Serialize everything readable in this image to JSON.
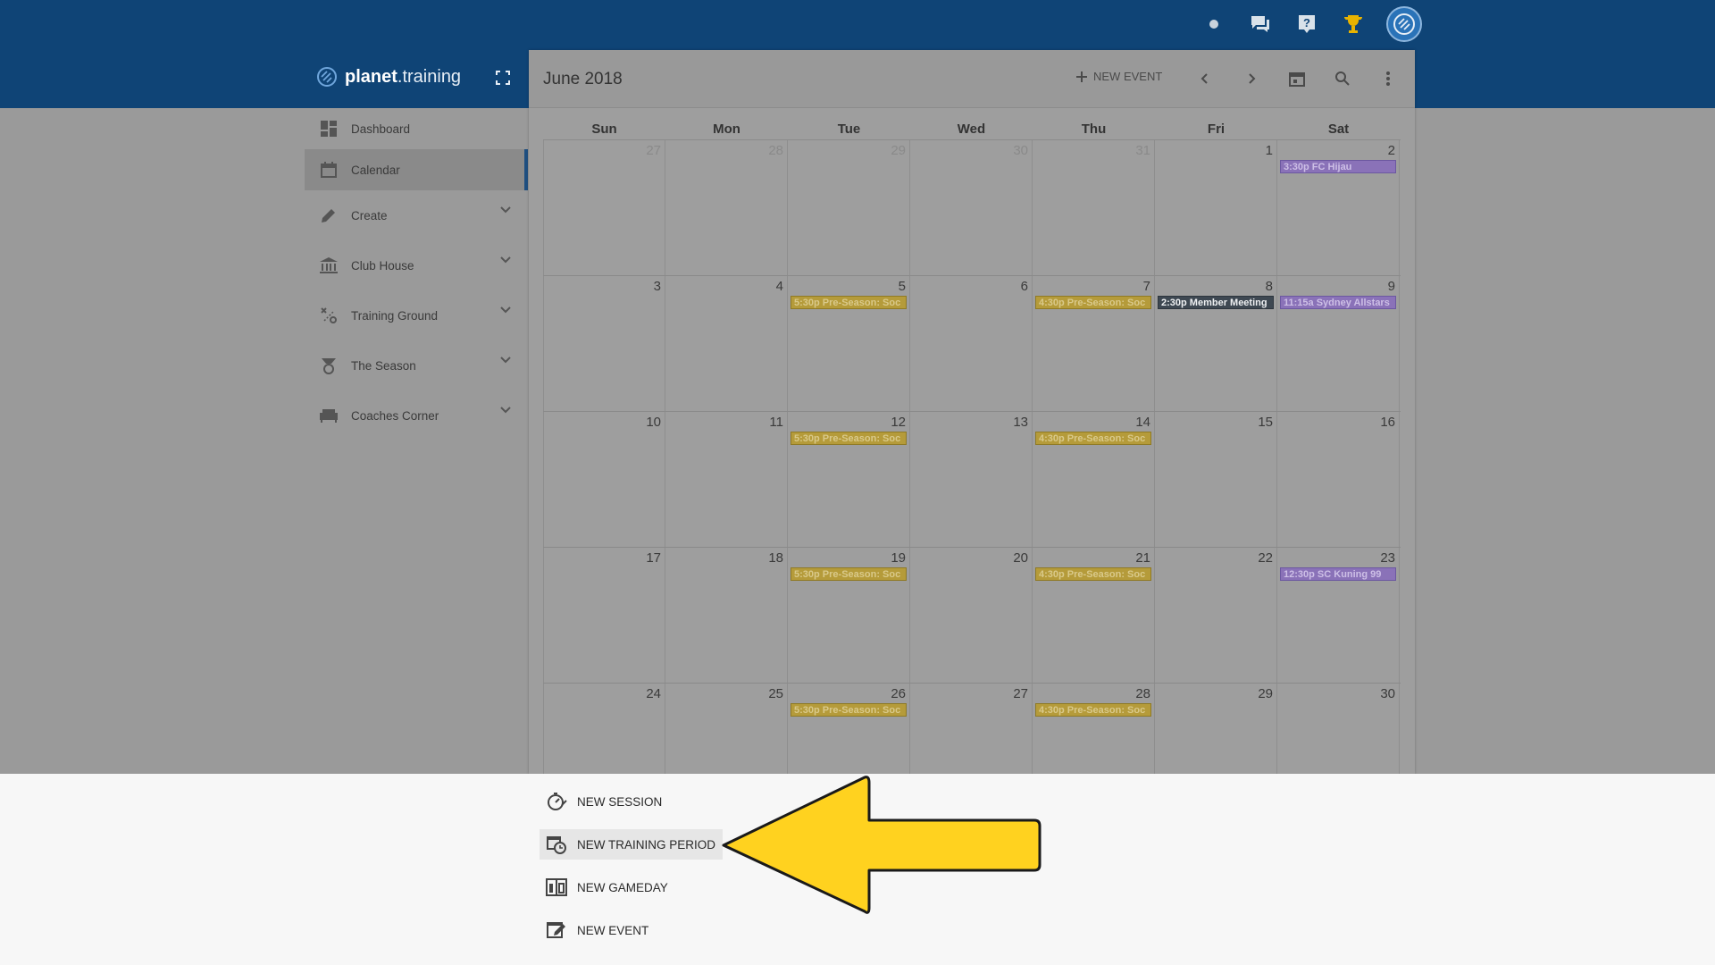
{
  "app": {
    "logo_bold": "planet",
    "logo_light": ".training"
  },
  "sidebar": {
    "items": [
      {
        "label": "Dashboard",
        "icon": "dashboard-icon"
      },
      {
        "label": "Calendar",
        "icon": "calendar-icon",
        "active": true
      },
      {
        "label": "Create",
        "icon": "pencil-icon",
        "expandable": true
      },
      {
        "label": "Club House",
        "icon": "building-icon",
        "expandable": true
      },
      {
        "label": "Training Ground",
        "icon": "tactics-icon",
        "expandable": true
      },
      {
        "label": "The Season",
        "icon": "trophy-icon",
        "expandable": true
      },
      {
        "label": "Coaches Corner",
        "icon": "couch-icon",
        "expandable": true
      }
    ]
  },
  "calendar": {
    "title": "June 2018",
    "new_event_label": "NEW EVENT",
    "days_of_week": [
      "Sun",
      "Mon",
      "Tue",
      "Wed",
      "Thu",
      "Fri",
      "Sat"
    ],
    "weeks": [
      [
        {
          "d": "27",
          "other": true
        },
        {
          "d": "28",
          "other": true
        },
        {
          "d": "29",
          "other": true
        },
        {
          "d": "30",
          "other": true
        },
        {
          "d": "31",
          "other": true
        },
        {
          "d": "1"
        },
        {
          "d": "2",
          "event": "3:30p FC Hijau",
          "color": "purple"
        }
      ],
      [
        {
          "d": "3"
        },
        {
          "d": "4"
        },
        {
          "d": "5",
          "event": "5:30p Pre-Season: Soc",
          "color": "gold"
        },
        {
          "d": "6"
        },
        {
          "d": "7",
          "event": "4:30p Pre-Season: Soc",
          "color": "gold"
        },
        {
          "d": "8",
          "event": "2:30p Member Meeting",
          "color": "dark"
        },
        {
          "d": "9",
          "event": "11:15a Sydney Allstars",
          "color": "purple"
        }
      ],
      [
        {
          "d": "10"
        },
        {
          "d": "11"
        },
        {
          "d": "12",
          "event": "5:30p Pre-Season: Soc",
          "color": "gold"
        },
        {
          "d": "13"
        },
        {
          "d": "14",
          "event": "4:30p Pre-Season: Soc",
          "color": "gold"
        },
        {
          "d": "15"
        },
        {
          "d": "16"
        }
      ],
      [
        {
          "d": "17"
        },
        {
          "d": "18"
        },
        {
          "d": "19",
          "event": "5:30p Pre-Season: Soc",
          "color": "gold"
        },
        {
          "d": "20"
        },
        {
          "d": "21",
          "event": "4:30p Pre-Season: Soc",
          "color": "gold"
        },
        {
          "d": "22"
        },
        {
          "d": "23",
          "event": "12:30p SC Kuning 99",
          "color": "purple"
        }
      ],
      [
        {
          "d": "24"
        },
        {
          "d": "25"
        },
        {
          "d": "26",
          "event": "5:30p Pre-Season: Soc",
          "color": "gold"
        },
        {
          "d": "27"
        },
        {
          "d": "28",
          "event": "4:30p Pre-Season: Soc",
          "color": "gold"
        },
        {
          "d": "29"
        },
        {
          "d": "30"
        }
      ]
    ]
  },
  "create_menu": {
    "items": [
      {
        "label": "NEW SESSION",
        "icon": "stopwatch-icon"
      },
      {
        "label": "NEW TRAINING PERIOD",
        "icon": "calendar-clock-icon",
        "highlighted": true
      },
      {
        "label": "NEW GAMEDAY",
        "icon": "scoreboard-icon"
      },
      {
        "label": "NEW EVENT",
        "icon": "edit-calendar-icon"
      }
    ]
  },
  "colors": {
    "topbar": "#0f4476",
    "arrow": "#ffd21f",
    "event_gold": "#b59b3a",
    "event_purple": "#8a72b8",
    "event_dark": "#3e4852"
  }
}
